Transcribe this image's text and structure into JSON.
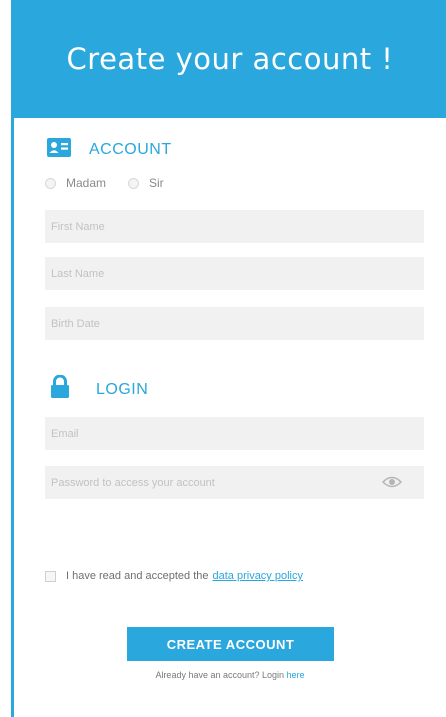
{
  "colors": {
    "accent": "#2aa7dd",
    "field_bg": "#f1f1f1"
  },
  "header": {
    "title": "Create your account !"
  },
  "account_section": {
    "icon": "id-card-icon",
    "title": "ACCOUNT",
    "civility_options": [
      "Madam",
      "Sir"
    ],
    "first_name_placeholder": "First Name",
    "last_name_placeholder": "Last Name",
    "birth_date_placeholder": "Birth Date"
  },
  "login_section": {
    "icon": "lock-icon",
    "title": "LOGIN",
    "email_placeholder": "Email",
    "password_placeholder": "Password to access your account",
    "toggle_icon": "eye-icon"
  },
  "consent": {
    "text": "I have read and accepted the",
    "link_text": "data privacy policy"
  },
  "submit": {
    "label": "CREATE ACCOUNT"
  },
  "footer": {
    "already_text": "Already have an account? Login",
    "login_link": "here"
  }
}
